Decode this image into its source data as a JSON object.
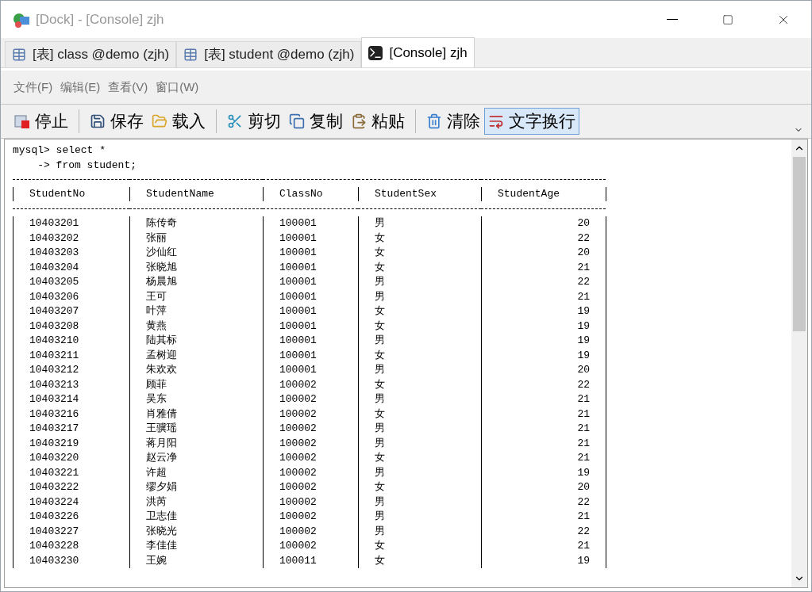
{
  "window": {
    "title": "[Dock] - [Console] zjh"
  },
  "tabs": [
    {
      "label": "[表] class @demo (zjh)",
      "kind": "table",
      "selected": false
    },
    {
      "label": "[表] student @demo (zjh)",
      "kind": "table",
      "selected": false
    },
    {
      "label": "[Console] zjh",
      "kind": "console",
      "selected": true
    }
  ],
  "menu": [
    "文件(F)",
    "编辑(E)",
    "查看(V)",
    "窗口(W)"
  ],
  "toolbar": {
    "groups": [
      [
        {
          "label": "停止",
          "kind": "stop",
          "pressed": false
        }
      ],
      [
        {
          "label": "保存",
          "kind": "save",
          "pressed": false
        },
        {
          "label": "载入",
          "kind": "load",
          "pressed": false
        }
      ],
      [
        {
          "label": "剪切",
          "kind": "cut",
          "pressed": false
        },
        {
          "label": "复制",
          "kind": "copy",
          "pressed": false
        },
        {
          "label": "粘贴",
          "kind": "paste",
          "pressed": false
        }
      ],
      [
        {
          "label": "清除",
          "kind": "clear",
          "pressed": false
        },
        {
          "label": "文字换行",
          "kind": "wrap",
          "pressed": true
        }
      ]
    ]
  },
  "console": {
    "command_lines": [
      "mysql> select *",
      "    -> from student;"
    ],
    "columns": [
      "StudentNo",
      "StudentName",
      "ClassNo",
      "StudentSex",
      "StudentAge"
    ],
    "rows": [
      [
        "10403201",
        "陈传奇",
        "100001",
        "男",
        "20"
      ],
      [
        "10403202",
        "张丽",
        "100001",
        "女",
        "22"
      ],
      [
        "10403203",
        "沙仙红",
        "100001",
        "女",
        "20"
      ],
      [
        "10403204",
        "张晓旭",
        "100001",
        "女",
        "21"
      ],
      [
        "10403205",
        "杨晨旭",
        "100001",
        "男",
        "22"
      ],
      [
        "10403206",
        "王可",
        "100001",
        "男",
        "21"
      ],
      [
        "10403207",
        "叶萍",
        "100001",
        "女",
        "19"
      ],
      [
        "10403208",
        "黄燕",
        "100001",
        "女",
        "19"
      ],
      [
        "10403210",
        "陆其标",
        "100001",
        "男",
        "19"
      ],
      [
        "10403211",
        "孟树迎",
        "100001",
        "女",
        "19"
      ],
      [
        "10403212",
        "朱欢欢",
        "100001",
        "男",
        "20"
      ],
      [
        "10403213",
        "顾菲",
        "100002",
        "女",
        "22"
      ],
      [
        "10403214",
        "吴东",
        "100002",
        "男",
        "21"
      ],
      [
        "10403216",
        "肖雅倩",
        "100002",
        "女",
        "21"
      ],
      [
        "10403217",
        "王骥瑶",
        "100002",
        "男",
        "21"
      ],
      [
        "10403219",
        "蒋月阳",
        "100002",
        "男",
        "21"
      ],
      [
        "10403220",
        "赵云净",
        "100002",
        "女",
        "21"
      ],
      [
        "10403221",
        "许超",
        "100002",
        "男",
        "19"
      ],
      [
        "10403222",
        "缪夕娟",
        "100002",
        "女",
        "20"
      ],
      [
        "10403224",
        "洪芮",
        "100002",
        "男",
        "22"
      ],
      [
        "10403226",
        "卫志佳",
        "100002",
        "男",
        "21"
      ],
      [
        "10403227",
        "张晓光",
        "100002",
        "男",
        "22"
      ],
      [
        "10403228",
        "李佳佳",
        "100002",
        "女",
        "21"
      ],
      [
        "10403230",
        "王婉",
        "100011",
        "女",
        "19"
      ]
    ]
  }
}
